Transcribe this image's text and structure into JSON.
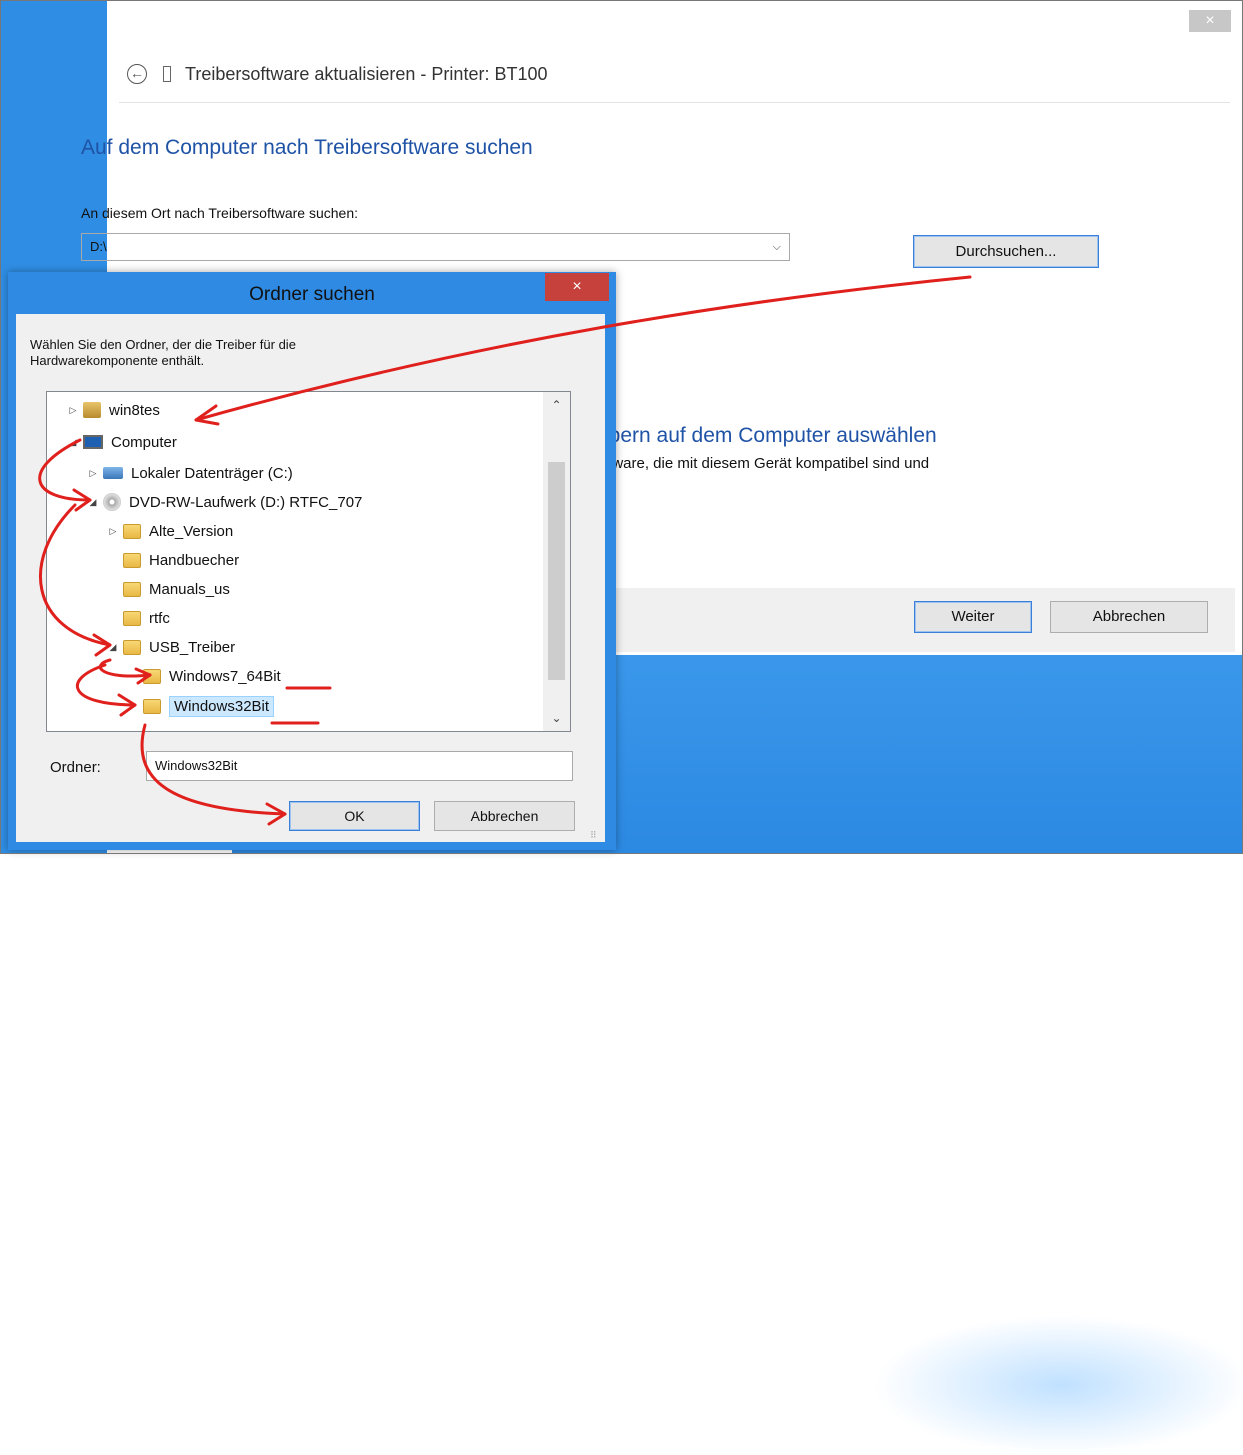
{
  "wizard": {
    "close_label": "×",
    "title": "Treibersoftware aktualisieren - Printer: BT100",
    "heading": "Auf dem Computer nach Treibersoftware suchen",
    "location_label": "An diesem Ort nach Treibersoftware suchen:",
    "path_value": "D:\\",
    "browse_button": "Durchsuchen...",
    "partial_option_heading": "ibern auf dem Computer auswählen",
    "partial_option_text": "ftware, die mit diesem Gerät kompatibel sind und",
    "next_button": "Weiter",
    "cancel_button": "Abbrechen"
  },
  "dialog": {
    "title": "Ordner suchen",
    "close_label": "×",
    "description_line1": "Wählen Sie den Ordner, der die Treiber für die",
    "description_line2": "Hardwarekomponente enthält.",
    "tree": [
      {
        "label": "win8tes",
        "icon": "user-folder-icon",
        "expander": "▷"
      },
      {
        "label": "Computer",
        "icon": "computer-icon",
        "expander": "◢"
      },
      {
        "label": "Lokaler Datenträger (C:)",
        "icon": "drive-icon",
        "expander": "▷"
      },
      {
        "label": "DVD-RW-Laufwerk (D:) RTFC_707",
        "icon": "dvd-icon",
        "expander": "◢"
      },
      {
        "label": "Alte_Version",
        "icon": "folder-icon",
        "expander": "▷"
      },
      {
        "label": "Handbuecher",
        "icon": "folder-icon",
        "expander": ""
      },
      {
        "label": "Manuals_us",
        "icon": "folder-icon",
        "expander": ""
      },
      {
        "label": "rtfc",
        "icon": "folder-icon",
        "expander": ""
      },
      {
        "label": "USB_Treiber",
        "icon": "folder-icon",
        "expander": "◢"
      },
      {
        "label": "Windows7_64Bit",
        "icon": "folder-icon",
        "expander": ""
      },
      {
        "label": "Windows32Bit",
        "icon": "folder-icon",
        "expander": "",
        "selected": true
      }
    ],
    "folder_label": "Ordner:",
    "folder_value": "Windows32Bit",
    "ok_button": "OK",
    "cancel_button": "Abbrechen"
  },
  "colors": {
    "accent_heading": "#1f53a6",
    "desktop_blue": "#2f8ee4",
    "annotation_red": "#e0201c",
    "close_red": "#c7413c"
  }
}
